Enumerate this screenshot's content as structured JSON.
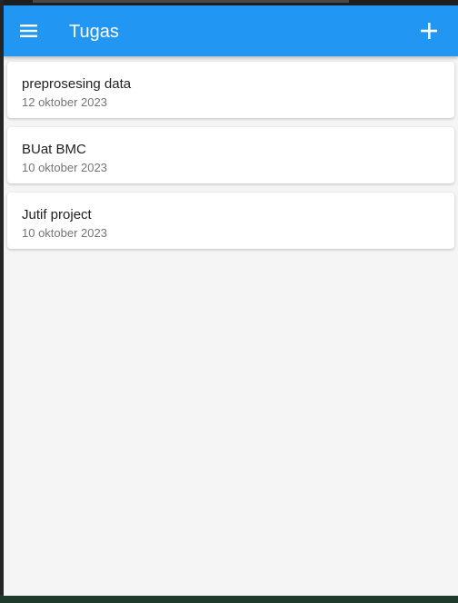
{
  "appbar": {
    "title": "Tugas",
    "color": "#2196f3"
  },
  "icons": {
    "menu": "menu-icon",
    "add": "plus-icon"
  },
  "tasks": [
    {
      "name": "preprosesing data",
      "date": "12 oktober 2023"
    },
    {
      "name": "BUat BMC",
      "date": "10 oktober 2023"
    },
    {
      "name": "Jutif project",
      "date": "10 oktober 2023"
    }
  ]
}
